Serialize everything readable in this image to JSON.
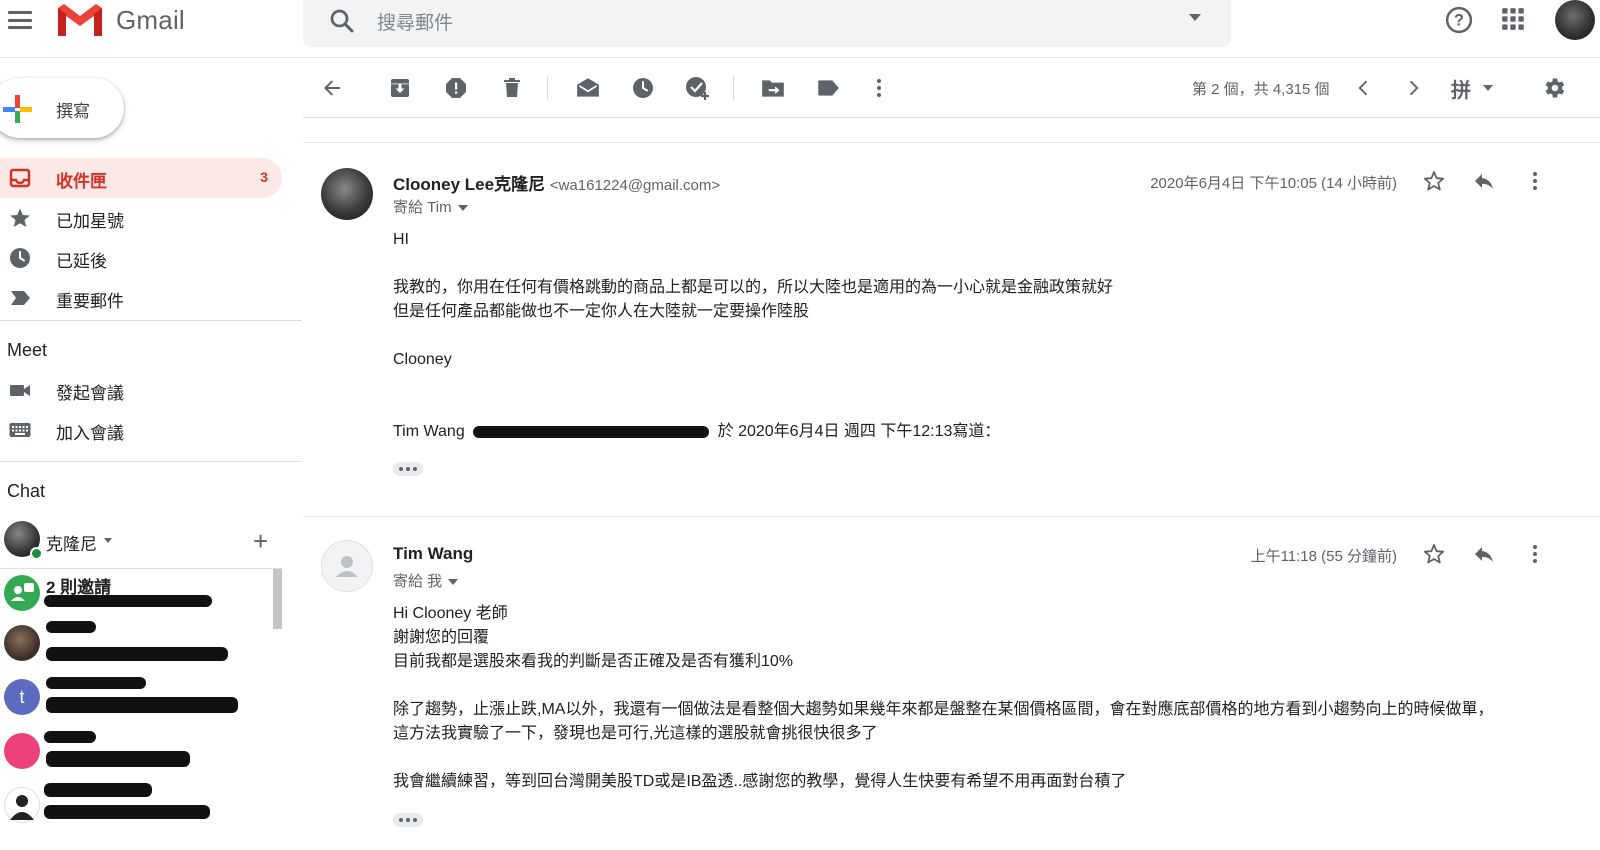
{
  "app": {
    "name": "Gmail"
  },
  "search": {
    "placeholder": "搜尋郵件"
  },
  "compose": {
    "label": "撰寫"
  },
  "sidebar": {
    "items": [
      {
        "label": "收件匣",
        "count": "3",
        "icon": "inbox-icon",
        "active": true
      },
      {
        "label": "已加星號",
        "icon": "star-icon"
      },
      {
        "label": "已延後",
        "icon": "clock-icon"
      },
      {
        "label": "重要郵件",
        "icon": "important-icon"
      }
    ]
  },
  "meet": {
    "title": "Meet",
    "items": [
      {
        "label": "發起會議",
        "icon": "video-icon"
      },
      {
        "label": "加入會議",
        "icon": "keyboard-icon"
      }
    ]
  },
  "chat": {
    "title": "Chat",
    "me": {
      "name": "克隆尼"
    },
    "items": [
      {
        "title": "2 則邀請",
        "subtitle": "",
        "avatar_color": "#34a853",
        "avatar_letter": ""
      },
      {
        "title": "",
        "subtitle": "",
        "avatar_color": "#3b2f28",
        "avatar_letter": ""
      },
      {
        "title": "",
        "subtitle": "",
        "avatar_color": "#5c6bc0",
        "avatar_letter": "t"
      },
      {
        "title": "",
        "subtitle": "",
        "avatar_color": "#ec407a",
        "avatar_letter": ""
      },
      {
        "title": "",
        "subtitle": "",
        "avatar_color": "#ffffff",
        "avatar_letter": ""
      }
    ]
  },
  "toolbar": {
    "count": "第 2 個，共 4,315 個",
    "lang": "拼",
    "icons": [
      "back-arrow-icon",
      "archive-icon",
      "report-spam-icon",
      "delete-icon",
      "mark-unread-icon",
      "snooze-icon",
      "add-to-tasks-icon",
      "move-to-icon",
      "label-icon",
      "more-vert-icon",
      "older-chevron-icon",
      "newer-chevron-icon",
      "settings-icon"
    ]
  },
  "messages": [
    {
      "sender": "Clooney Lee克隆尼",
      "email": "<wa161224@gmail.com>",
      "to": "寄給 Tim",
      "date": "2020年6月4日 下午10:05 (14 小時前)",
      "body": [
        "HI",
        "",
        " 我教的，你用在任何有價格跳動的商品上都是可以的，所以大陸也是適用的為一小心就是金融政策就好",
        "但是任何產品都能做也不一定你人在大陸就一定要操作陸股",
        "",
        "Clooney",
        "",
        ""
      ],
      "quote_prefix": "Tim Wang",
      "quote_suffix": "於 2020年6月4日 週四 下午12:13寫道："
    },
    {
      "sender": "Tim Wang",
      "email": "",
      "to": "寄給 我",
      "date": "上午11:18 (55 分鐘前)",
      "body": [
        "Hi Clooney 老師",
        "謝謝您的回覆",
        "目前我都是選股來看我的判斷是否正確及是否有獲利10%",
        "",
        "除了趨勢，止漲止跌,MA以外，我還有一個做法是看整個大趨勢如果幾年來都是盤整在某個價格區間，會在對應底部價格的地方看到小趨勢向上的時候做單，",
        "這方法我實驗了一下，發現也是可行,光這樣的選股就會挑很快很多了",
        "",
        "我會繼續練習，等到回台灣開美股TD或是IB盈透..感謝您的教學，覺得人生快要有希望不用再面對台積了"
      ]
    }
  ],
  "colors": {
    "accent": "#d93025",
    "active_bg": "#fce8e6",
    "muted": "#5f6368"
  }
}
